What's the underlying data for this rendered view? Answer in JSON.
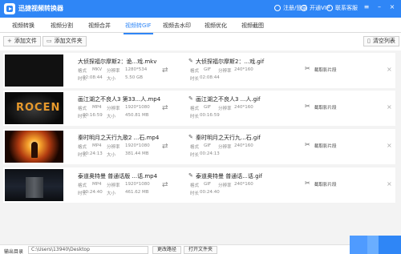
{
  "app": {
    "title": "迅捷视频转换器",
    "login_label": "注册/登录",
    "vip_label": "开通VIP",
    "support_label": "联系客服",
    "colors": {
      "accent": "#2f86f6"
    }
  },
  "tabs": [
    {
      "label": "视频转换"
    },
    {
      "label": "视频分割"
    },
    {
      "label": "视频合并"
    },
    {
      "label": "视频转GIF",
      "active": true
    },
    {
      "label": "视频去水印"
    },
    {
      "label": "视频优化"
    },
    {
      "label": "视频截图"
    }
  ],
  "toolbar": {
    "add_file": "添加文件",
    "add_folder": "添加文件夹",
    "clear_list": "清空列表"
  },
  "labels": {
    "format": "格式",
    "resolution": "分辨率",
    "duration": "时长",
    "size": "大小",
    "clip": "截取影片段"
  },
  "rows": [
    {
      "src_name": "大侦探福尔摩斯2：诡...戏.mkv",
      "src_format": "MKV",
      "src_res": "1280*534",
      "src_dur": "02:08:44",
      "src_size": "5.50 GB",
      "dst_name": "大侦探福尔摩斯2：...戏.gif",
      "dst_format": "GIF",
      "dst_res": "240*160",
      "dst_dur": "02:08:44"
    },
    {
      "src_name": "画江湖之不良人3 第33...人.mp4",
      "src_format": "MP4",
      "src_res": "1920*1080",
      "src_dur": "00:16:59",
      "src_size": "450.81 MB",
      "dst_name": "画江湖之不良人3 ...人.gif",
      "dst_format": "GIF",
      "dst_res": "240*160",
      "dst_dur": "00:16:59"
    },
    {
      "src_name": "秦时明月之天行九歌2 ...石.mp4",
      "src_format": "MP4",
      "src_res": "1920*1080",
      "src_dur": "00:24:13",
      "src_size": "381.44 MB",
      "dst_name": "秦时明月之天行九...石.gif",
      "dst_format": "GIF",
      "dst_res": "240*160",
      "dst_dur": "00:24:13"
    },
    {
      "src_name": "泰道奥特曼 普通话版 ...话.mp4",
      "src_format": "MP4",
      "src_res": "1920*1080",
      "src_dur": "00:24:40",
      "src_size": "461.62 MB",
      "dst_name": "泰道奥特曼 普通话...话.gif",
      "dst_format": "GIF",
      "dst_res": "240*160",
      "dst_dur": "00:24:40"
    }
  ],
  "thumbnail_text": {
    "row2_logo": "ROCEN"
  },
  "bottom": {
    "output_label": "输出目录",
    "output_path": "C:\\Users\\13940\\Desktop",
    "change_path": "更改路径",
    "open_folder": "打开文件夹"
  }
}
